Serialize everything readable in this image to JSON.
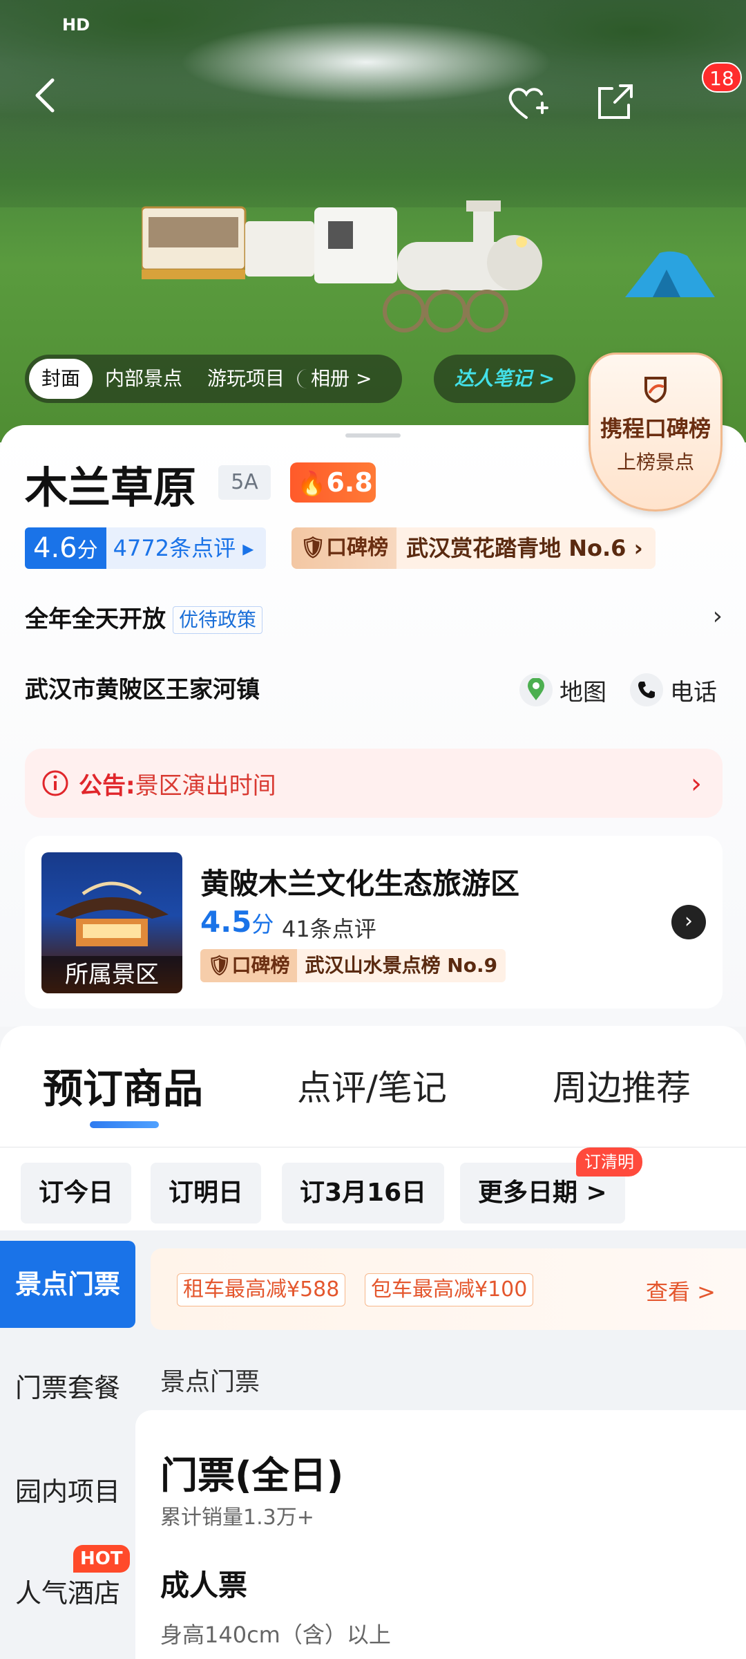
{
  "status": {
    "left": "HD",
    "right": ""
  },
  "hero": {
    "media_tabs": [
      "封面",
      "内部景点",
      "游玩项目",
      "相册 >"
    ],
    "expert_notes": "达人笔记 >",
    "message_count": "18",
    "rank_badge": {
      "line1": "携程口碑榜",
      "line2": "上榜景点"
    }
  },
  "spot": {
    "name": "木兰草原",
    "level": "5A",
    "heat": "6.8",
    "score": "4.6",
    "score_unit": "分",
    "review_count": "4772条点评",
    "board_tag": "口碑榜",
    "board_text": "武汉赏花踏青地 No.6",
    "open_hours": "全年全天开放",
    "policy": "优待政策",
    "address": "武汉市黄陂区王家河镇",
    "map_label": "地图",
    "phone_label": "电话"
  },
  "notice": {
    "label": "公告:",
    "text": "景区演出时间"
  },
  "parent_area": {
    "thumb_label": "所属景区",
    "name": "黄陂木兰文化生态旅游区",
    "score": "4.5",
    "score_unit": "分",
    "review_count": "41条点评",
    "board_tag": "口碑榜",
    "board_text": "武汉山水景点榜 No.9"
  },
  "tabs": [
    "预订商品",
    "点评/笔记",
    "周边推荐"
  ],
  "dates": [
    "订今日",
    "订明日",
    "订3月16日",
    "更多日期 >"
  ],
  "dates_badge": "订清明",
  "sidebar": [
    "景点门票",
    "门票套餐",
    "园内项目",
    "人气酒店"
  ],
  "hot_badge": "HOT",
  "promo": {
    "pill1": "租车最高减¥588",
    "pill2": "包车最高减¥100",
    "view": "查看 >"
  },
  "section_title": "景点门票",
  "ticket": {
    "name": "门票(全日)",
    "sales": "累计销量1.3万+",
    "type": "成人票",
    "desc": "身高140cm（含）以上"
  }
}
